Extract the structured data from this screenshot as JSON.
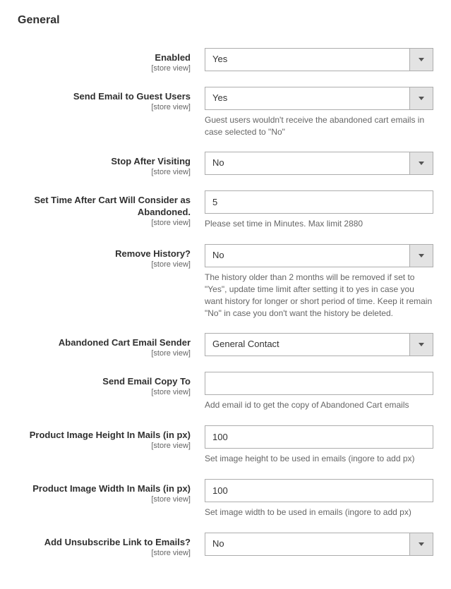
{
  "section_title": "General",
  "scope": "[store view]",
  "fields": {
    "enabled": {
      "label": "Enabled",
      "value": "Yes"
    },
    "send_guest": {
      "label": "Send Email to Guest Users",
      "value": "Yes",
      "help": "Guest users wouldn't receive the abandoned cart emails in case selected to \"No\""
    },
    "stop_after": {
      "label": "Stop After Visiting",
      "value": "No"
    },
    "set_time": {
      "label": "Set Time After Cart Will Consider as Abandoned.",
      "value": "5",
      "help": "Please set time in Minutes. Max limit 2880"
    },
    "remove_history": {
      "label": "Remove History?",
      "value": "No",
      "help": "The history older than 2 months will be removed if set to \"Yes\", update time limit after setting it to yes in case you want history for longer or short period of time. Keep it remain \"No\" in case you don't want the history be deleted."
    },
    "email_sender": {
      "label": "Abandoned Cart Email Sender",
      "value": "General Contact"
    },
    "email_copy": {
      "label": "Send Email Copy To",
      "value": "",
      "help": "Add email id to get the copy of Abandoned Cart emails"
    },
    "img_height": {
      "label": "Product Image Height In Mails (in px)",
      "value": "100",
      "help": "Set image height to be used in emails (ingore to add px)"
    },
    "img_width": {
      "label": "Product Image Width In Mails (in px)",
      "value": "100",
      "help": "Set image width to be used in emails (ingore to add px)"
    },
    "unsubscribe": {
      "label": "Add Unsubscribe Link to Emails?",
      "value": "No"
    }
  }
}
